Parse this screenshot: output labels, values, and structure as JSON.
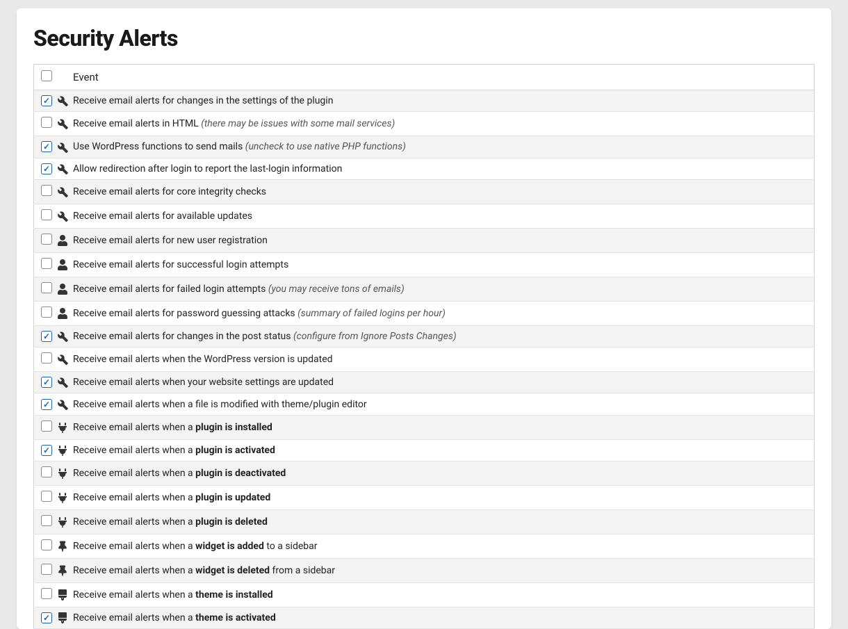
{
  "page_title": "Security Alerts",
  "header_col_label": "Event",
  "header_checked": false,
  "rows": [
    {
      "checked": true,
      "icon": "wrench",
      "text": "Receive email alerts for changes in the settings of the plugin"
    },
    {
      "checked": false,
      "icon": "wrench",
      "text": "Receive email alerts in HTML ",
      "suffix_italic": "(there may be issues with some mail services)"
    },
    {
      "checked": true,
      "icon": "wrench",
      "text": "Use WordPress functions to send mails ",
      "suffix_italic": "(uncheck to use native PHP functions)"
    },
    {
      "checked": true,
      "icon": "wrench",
      "text": "Allow redirection after login to report the last-login information"
    },
    {
      "checked": false,
      "icon": "wrench",
      "text": "Receive email alerts for core integrity checks"
    },
    {
      "checked": false,
      "icon": "wrench",
      "text": "Receive email alerts for available updates"
    },
    {
      "checked": false,
      "icon": "user",
      "text": "Receive email alerts for new user registration"
    },
    {
      "checked": false,
      "icon": "user",
      "text": "Receive email alerts for successful login attempts"
    },
    {
      "checked": false,
      "icon": "user",
      "text": "Receive email alerts for failed login attempts ",
      "suffix_italic": "(you may receive tons of emails)"
    },
    {
      "checked": false,
      "icon": "user",
      "text": "Receive email alerts for password guessing attacks ",
      "suffix_italic": "(summary of failed logins per hour)"
    },
    {
      "checked": true,
      "icon": "wrench",
      "text": "Receive email alerts for changes in the post status ",
      "suffix_italic": "(configure from Ignore Posts Changes)"
    },
    {
      "checked": false,
      "icon": "wrench",
      "text": "Receive email alerts when the WordPress version is updated"
    },
    {
      "checked": true,
      "icon": "wrench",
      "text": "Receive email alerts when your website settings are updated"
    },
    {
      "checked": true,
      "icon": "wrench",
      "text": "Receive email alerts when a file is modified with theme/plugin editor"
    },
    {
      "checked": false,
      "icon": "plug",
      "text": "Receive email alerts when a ",
      "bold": "plugin is installed"
    },
    {
      "checked": true,
      "icon": "plug",
      "text": "Receive email alerts when a ",
      "bold": "plugin is activated"
    },
    {
      "checked": false,
      "icon": "plug",
      "text": "Receive email alerts when a ",
      "bold": "plugin is deactivated"
    },
    {
      "checked": false,
      "icon": "plug",
      "text": "Receive email alerts when a ",
      "bold": "plugin is updated"
    },
    {
      "checked": false,
      "icon": "plug",
      "text": "Receive email alerts when a ",
      "bold": "plugin is deleted"
    },
    {
      "checked": false,
      "icon": "pin",
      "text": "Receive email alerts when a ",
      "bold": "widget is added",
      "suffix_text": " to a sidebar"
    },
    {
      "checked": false,
      "icon": "pin",
      "text": "Receive email alerts when a ",
      "bold": "widget is deleted",
      "suffix_text": " from a sidebar"
    },
    {
      "checked": false,
      "icon": "brush",
      "text": "Receive email alerts when a ",
      "bold": "theme is installed"
    },
    {
      "checked": true,
      "icon": "brush",
      "text": "Receive email alerts when a ",
      "bold": "theme is activated"
    }
  ]
}
